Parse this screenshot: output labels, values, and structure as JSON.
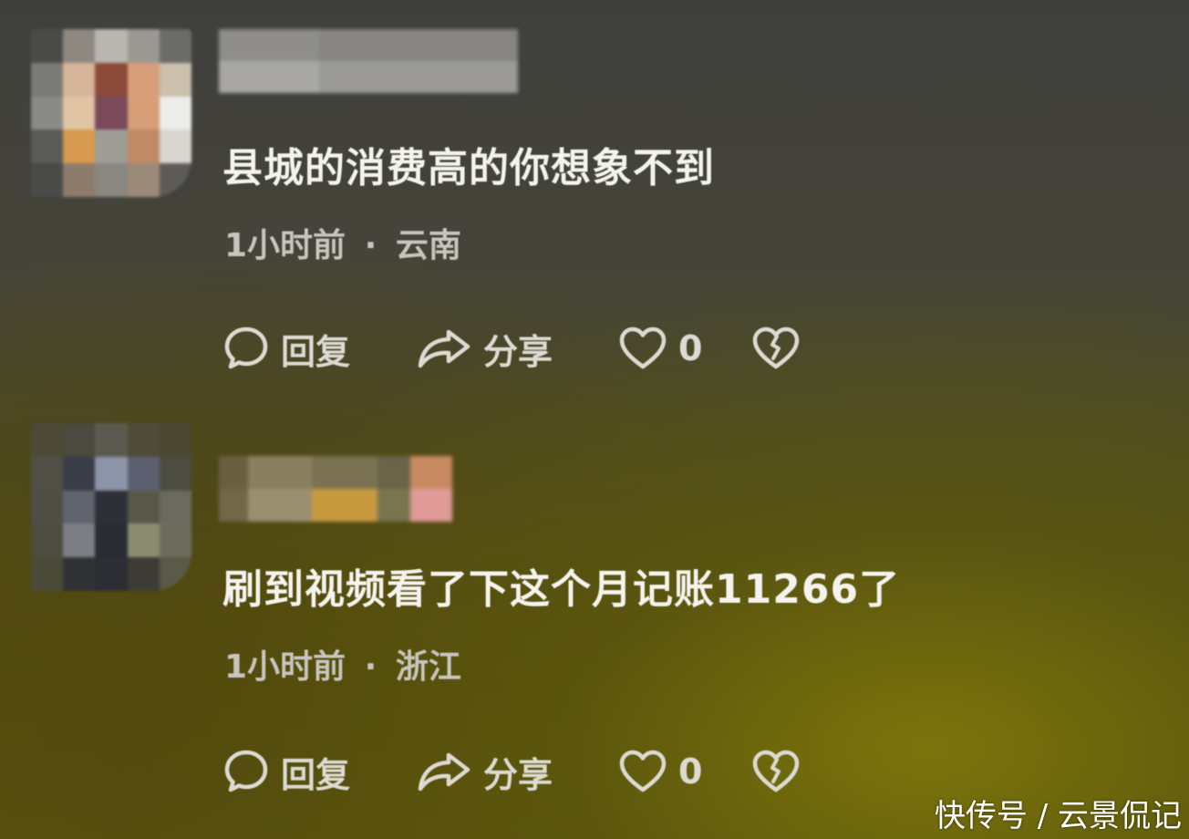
{
  "comments": [
    {
      "text": "县城的消费高的你想象不到",
      "time": "1小时前",
      "location": "云南",
      "actions": {
        "reply_label": "回复",
        "share_label": "分享",
        "like_count": "0"
      }
    },
    {
      "text": "刷到视频看了下这个月记账11266了",
      "time": "1小时前",
      "location": "浙江",
      "actions": {
        "reply_label": "回复",
        "share_label": "分享",
        "like_count": "0"
      }
    }
  ],
  "meta_separator": "·",
  "watermark": "快传号 / 云景侃记",
  "icons": {
    "reply": "speech-bubble-icon",
    "share": "share-arrow-icon",
    "like": "heart-icon",
    "dislike": "broken-heart-icon"
  }
}
